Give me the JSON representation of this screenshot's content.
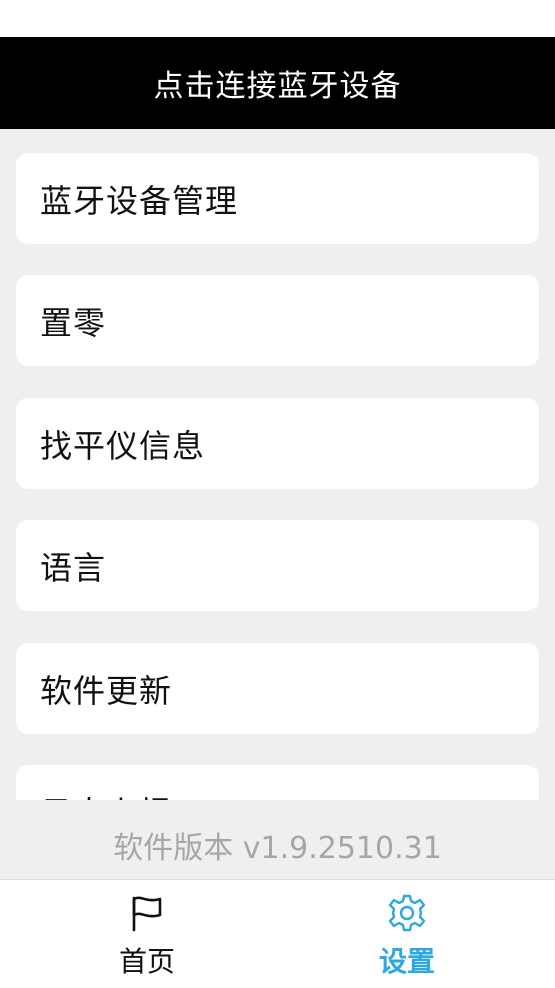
{
  "header": {
    "title": "点击连接蓝牙设备"
  },
  "menu": {
    "items": [
      {
        "label": "蓝牙设备管理"
      },
      {
        "label": "置零"
      },
      {
        "label": "找平仪信息"
      },
      {
        "label": "语言"
      },
      {
        "label": "软件更新"
      },
      {
        "label": "日志上报"
      }
    ]
  },
  "footer": {
    "version": "软件版本 v1.9.2510.31"
  },
  "tabs": [
    {
      "label": "首页",
      "icon": "flag-icon",
      "color": "#111111"
    },
    {
      "label": "设置",
      "icon": "gear-icon",
      "color": "#2fa8e0",
      "active": true
    }
  ],
  "colors": {
    "header_bg": "#000000",
    "page_bg": "#efefef",
    "accent": "#2fa8e0",
    "version_text": "#a6a6a6"
  }
}
